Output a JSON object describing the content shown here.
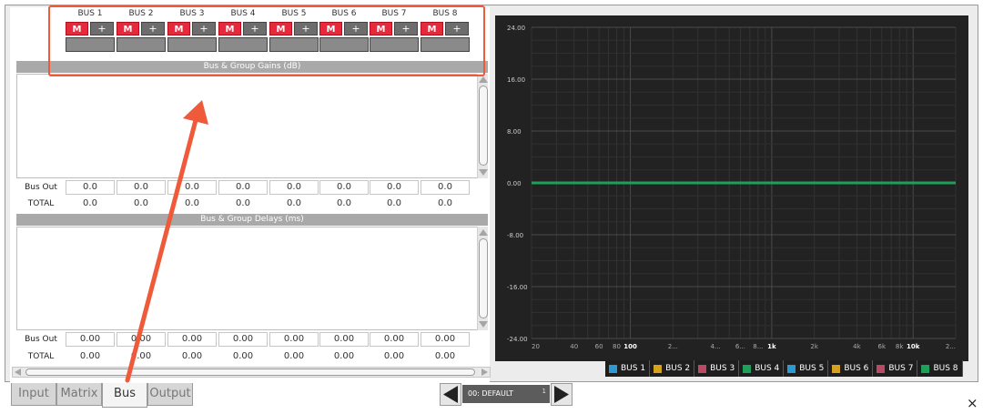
{
  "buses": [
    {
      "label": "BUS 1",
      "mute": "M",
      "add": "+"
    },
    {
      "label": "BUS 2",
      "mute": "M",
      "add": "+"
    },
    {
      "label": "BUS 3",
      "mute": "M",
      "add": "+"
    },
    {
      "label": "BUS 4",
      "mute": "M",
      "add": "+"
    },
    {
      "label": "BUS 5",
      "mute": "M",
      "add": "+"
    },
    {
      "label": "BUS 6",
      "mute": "M",
      "add": "+"
    },
    {
      "label": "BUS 7",
      "mute": "M",
      "add": "+"
    },
    {
      "label": "BUS 8",
      "mute": "M",
      "add": "+"
    }
  ],
  "gains": {
    "title": "Bus & Group Gains (dB)",
    "bus_out_label": "Bus Out",
    "total_label": "TOTAL",
    "bus_out": [
      "0.0",
      "0.0",
      "0.0",
      "0.0",
      "0.0",
      "0.0",
      "0.0",
      "0.0"
    ],
    "total": [
      "0.0",
      "0.0",
      "0.0",
      "0.0",
      "0.0",
      "0.0",
      "0.0",
      "0.0"
    ]
  },
  "delays": {
    "title": "Bus & Group Delays (ms)",
    "bus_out_label": "Bus Out",
    "total_label": "TOTAL",
    "bus_out": [
      "0.00",
      "0.00",
      "0.00",
      "0.00",
      "0.00",
      "0.00",
      "0.00",
      "0.00"
    ],
    "total": [
      "0.00",
      "0.00",
      "0.00",
      "0.00",
      "0.00",
      "0.00",
      "0.00",
      "0.00"
    ]
  },
  "tabs": [
    {
      "label": "Input",
      "active": false
    },
    {
      "label": "Matrix",
      "active": false
    },
    {
      "label": "Bus",
      "active": true
    },
    {
      "label": "Output",
      "active": false
    }
  ],
  "preset": {
    "name": "00: DEFAULT",
    "number": "1"
  },
  "close_symbol": "×",
  "colors": {
    "accent_red": "#e8293b",
    "annotation": "#ee5a3a",
    "trace_green": "#1fa05a"
  },
  "chart_data": {
    "type": "line",
    "xscale": "log",
    "xlim": [
      20,
      20000
    ],
    "ylim": [
      -24,
      24
    ],
    "yticks": [
      "24.00",
      "16.00",
      "8.00",
      "0.00",
      "-8.00",
      "-16.00",
      "-24.00"
    ],
    "xticks": [
      {
        "value": 20,
        "label": "20"
      },
      {
        "value": 40,
        "label": "40"
      },
      {
        "value": 60,
        "label": "60"
      },
      {
        "value": 80,
        "label": "80"
      },
      {
        "value": 100,
        "label": "100"
      },
      {
        "value": 200,
        "label": "2..."
      },
      {
        "value": 400,
        "label": "4..."
      },
      {
        "value": 600,
        "label": "6..."
      },
      {
        "value": 800,
        "label": "8..."
      },
      {
        "value": 1000,
        "label": "1k"
      },
      {
        "value": 2000,
        "label": "2k"
      },
      {
        "value": 4000,
        "label": "4k"
      },
      {
        "value": 6000,
        "label": "6k"
      },
      {
        "value": 8000,
        "label": "8k"
      },
      {
        "value": 10000,
        "label": "10k"
      },
      {
        "value": 20000,
        "label": "2..."
      }
    ],
    "grid": true,
    "legend": "bottom-right",
    "series": [
      {
        "name": "BUS 1",
        "color": "#2a9bd0",
        "x": [
          20,
          20000
        ],
        "y": [
          0,
          0
        ]
      },
      {
        "name": "BUS 2",
        "color": "#d6a21e",
        "x": [
          20,
          20000
        ],
        "y": [
          0,
          0
        ]
      },
      {
        "name": "BUS 3",
        "color": "#b84a64",
        "x": [
          20,
          20000
        ],
        "y": [
          0,
          0
        ]
      },
      {
        "name": "BUS 4",
        "color": "#1fa05a",
        "x": [
          20,
          20000
        ],
        "y": [
          0,
          0
        ]
      },
      {
        "name": "BUS 5",
        "color": "#2a9bd0",
        "x": [
          20,
          20000
        ],
        "y": [
          0,
          0
        ]
      },
      {
        "name": "BUS 6",
        "color": "#d6a21e",
        "x": [
          20,
          20000
        ],
        "y": [
          0,
          0
        ]
      },
      {
        "name": "BUS 7",
        "color": "#b84a64",
        "x": [
          20,
          20000
        ],
        "y": [
          0,
          0
        ]
      },
      {
        "name": "BUS 8",
        "color": "#1fa05a",
        "x": [
          20,
          20000
        ],
        "y": [
          0,
          0
        ]
      }
    ]
  }
}
